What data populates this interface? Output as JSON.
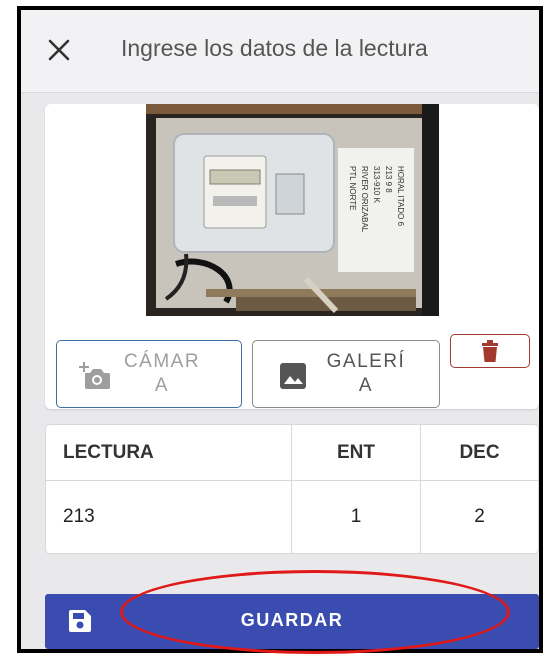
{
  "header": {
    "title": "Ingrese los datos de la lectura",
    "close_icon": "close-icon"
  },
  "photo": {
    "label_lines": [
      "PTL NORTE",
      "RIVER ORIZABAL",
      "313-910 K",
      "213 9 8",
      "HORAL ITADO 6"
    ]
  },
  "actions": {
    "camera_label": "CÁMARA",
    "camera_icon": "add-camera-icon",
    "gallery_label": "GALERÍA",
    "gallery_icon": "image-icon",
    "delete_icon": "trash-icon"
  },
  "reading_table": {
    "headers": [
      "LECTURA",
      "ENT",
      "DEC"
    ],
    "row": [
      "213",
      "1",
      "2"
    ]
  },
  "save": {
    "label": "GUARDAR",
    "icon": "floppy-disk-icon"
  },
  "colors": {
    "primary": "#3a4cb0",
    "camera_border": "#3e6ea0",
    "delete": "#a23a30",
    "highlight": "#e01818"
  }
}
